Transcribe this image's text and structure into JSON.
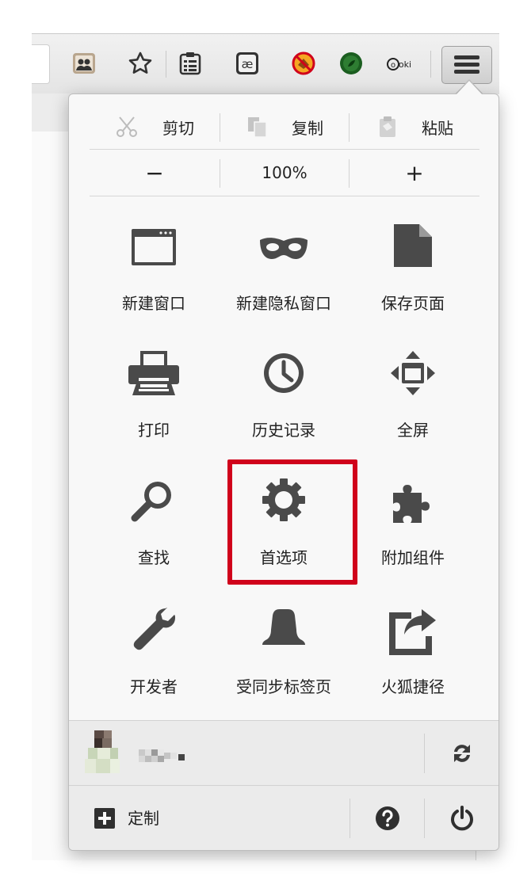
{
  "edit_row": {
    "cut": "剪切",
    "copy": "复制",
    "paste": "粘贴"
  },
  "zoom_row": {
    "zoom_out": "−",
    "zoom_level": "100%",
    "zoom_in": "+"
  },
  "grid": [
    {
      "label": "新建窗口",
      "icon": "new-window-icon"
    },
    {
      "label": "新建隐私窗口",
      "icon": "private-mask-icon"
    },
    {
      "label": "保存页面",
      "icon": "save-page-icon"
    },
    {
      "label": "打印",
      "icon": "printer-icon"
    },
    {
      "label": "历史记录",
      "icon": "history-clock-icon"
    },
    {
      "label": "全屏",
      "icon": "fullscreen-icon"
    },
    {
      "label": "查找",
      "icon": "find-magnifier-icon"
    },
    {
      "label": "首选项",
      "icon": "gear-icon"
    },
    {
      "label": "附加组件",
      "icon": "puzzle-icon"
    },
    {
      "label": "开发者",
      "icon": "wrench-icon"
    },
    {
      "label": "受同步标签页",
      "icon": "synced-tabs-icon"
    },
    {
      "label": "火狐捷径",
      "icon": "share-shortcut-icon"
    }
  ],
  "footer": {
    "customize": "定制"
  },
  "colors": {
    "highlight": "#d0021b",
    "icon": "#4a4a4a"
  }
}
